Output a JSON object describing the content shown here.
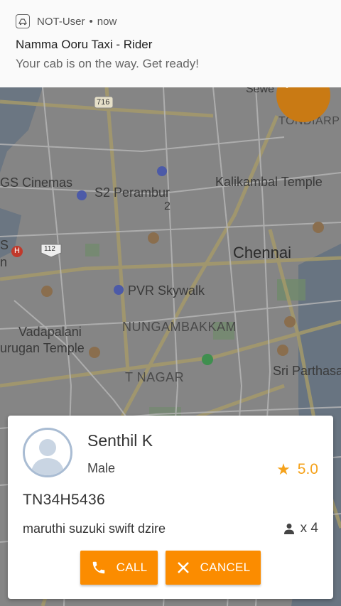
{
  "notification": {
    "app_name": "NOT-User",
    "separator": "•",
    "time": "now",
    "title": "Namma Ooru Taxi - Rider",
    "body": "Your cab is on the way. Get ready!",
    "icon": "taxi-app-icon"
  },
  "map": {
    "labels": {
      "sewe": "Sewe",
      "tondiarp": "TONDIARP",
      "gs_cinemas": "GS Cinemas",
      "s2_perambur": "S2 Perambur",
      "s2_line2": "2",
      "kalikambal": "Kalikambal Temple",
      "chennai": "Chennai",
      "pvr": "PVR Skywalk",
      "vadapalani": "Vadapalani",
      "murugan": "urugan Temple",
      "nungambakkam": "NUNGAMBAKKAM",
      "sri_parthasa": "Sri Parthasa",
      "t_nagar": "T NAGAR",
      "route_716": "716",
      "route_112": "112",
      "left_s": "S",
      "left_n": "n",
      "hospital": "H"
    }
  },
  "driver": {
    "name": "Senthil K",
    "gender": "Male",
    "rating": "5.0",
    "plate": "TN34H5436",
    "car": "maruthi suzuki swift dzire",
    "seats": "x 4"
  },
  "actions": {
    "call_label": "CALL",
    "cancel_label": "CANCEL"
  },
  "colors": {
    "accent": "#fb8c00",
    "rating": "#f5a21b"
  }
}
